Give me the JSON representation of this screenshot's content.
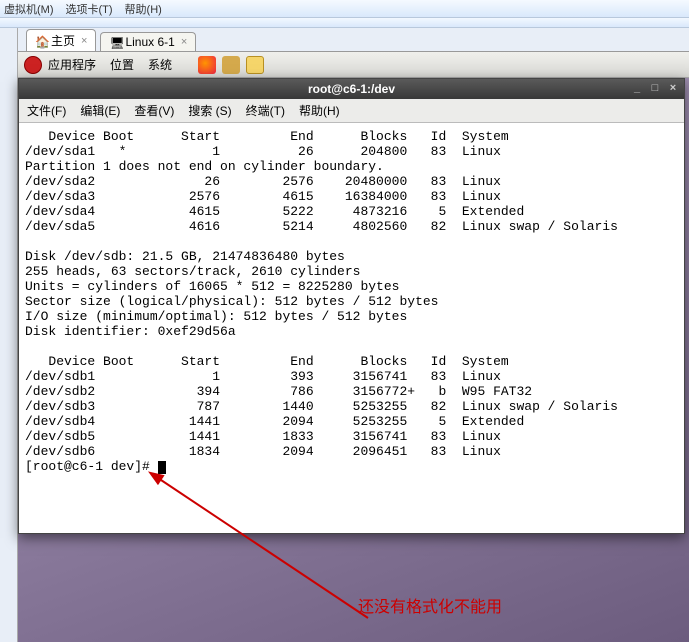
{
  "app_menu": {
    "vm": "虚拟机(M)",
    "tabs": "选项卡(T)",
    "help": "帮助(H)"
  },
  "host_tabs": {
    "home": "主页",
    "vm": "Linux 6-1"
  },
  "gnome": {
    "apps": "应用程序",
    "places": "位置",
    "system": "系统"
  },
  "terminal": {
    "title": "root@c6-1:/dev",
    "menu": {
      "file": "文件(F)",
      "edit": "编辑(E)",
      "view": "查看(V)",
      "search": "搜索 (S)",
      "terminal": "终端(T)",
      "help": "帮助(H)"
    },
    "output": {
      "hdr1": "   Device Boot      Start         End      Blocks   Id  System",
      "sda1": "/dev/sda1   *           1          26      204800   83  Linux",
      "pwarn": "Partition 1 does not end on cylinder boundary.",
      "sda2": "/dev/sda2              26        2576    20480000   83  Linux",
      "sda3": "/dev/sda3            2576        4615    16384000   83  Linux",
      "sda4": "/dev/sda4            4615        5222     4873216    5  Extended",
      "sda5": "/dev/sda5            4616        5214     4802560   82  Linux swap / Solaris",
      "blank1": "",
      "disk": "Disk /dev/sdb: 21.5 GB, 21474836480 bytes",
      "heads": "255 heads, 63 sectors/track, 2610 cylinders",
      "units": "Units = cylinders of 16065 * 512 = 8225280 bytes",
      "sector": "Sector size (logical/physical): 512 bytes / 512 bytes",
      "io": "I/O size (minimum/optimal): 512 bytes / 512 bytes",
      "ident": "Disk identifier: 0xef29d56a",
      "blank2": "",
      "hdr2": "   Device Boot      Start         End      Blocks   Id  System",
      "sdb1": "/dev/sdb1               1         393     3156741   83  Linux",
      "sdb2": "/dev/sdb2             394         786     3156772+   b  W95 FAT32",
      "sdb3": "/dev/sdb3             787        1440     5253255   82  Linux swap / Solaris",
      "sdb4": "/dev/sdb4            1441        2094     5253255    5  Extended",
      "sdb5": "/dev/sdb5            1441        1833     3156741   83  Linux",
      "sdb6": "/dev/sdb6            1834        2094     2096451   83  Linux",
      "prompt": "[root@c6-1 dev]# "
    }
  },
  "annotation": "还没有格式化不能用",
  "chart_data": {
    "type": "table",
    "title": "fdisk -l partition listing",
    "tables": [
      {
        "columns": [
          "Device",
          "Boot",
          "Start",
          "End",
          "Blocks",
          "Id",
          "System"
        ],
        "rows": [
          [
            "/dev/sda1",
            "*",
            1,
            26,
            204800,
            "83",
            "Linux"
          ],
          [
            "/dev/sda2",
            "",
            26,
            2576,
            20480000,
            "83",
            "Linux"
          ],
          [
            "/dev/sda3",
            "",
            2576,
            4615,
            16384000,
            "83",
            "Linux"
          ],
          [
            "/dev/sda4",
            "",
            4615,
            5222,
            4873216,
            "5",
            "Extended"
          ],
          [
            "/dev/sda5",
            "",
            4616,
            5214,
            4802560,
            "82",
            "Linux swap / Solaris"
          ]
        ]
      },
      {
        "disk_line": "Disk /dev/sdb: 21.5 GB, 21474836480 bytes",
        "columns": [
          "Device",
          "Boot",
          "Start",
          "End",
          "Blocks",
          "Id",
          "System"
        ],
        "rows": [
          [
            "/dev/sdb1",
            "",
            1,
            393,
            3156741,
            "83",
            "Linux"
          ],
          [
            "/dev/sdb2",
            "",
            394,
            786,
            "3156772+",
            "b",
            "W95 FAT32"
          ],
          [
            "/dev/sdb3",
            "",
            787,
            1440,
            5253255,
            "82",
            "Linux swap / Solaris"
          ],
          [
            "/dev/sdb4",
            "",
            1441,
            2094,
            5253255,
            "5",
            "Extended"
          ],
          [
            "/dev/sdb5",
            "",
            1441,
            1833,
            3156741,
            "83",
            "Linux"
          ],
          [
            "/dev/sdb6",
            "",
            1834,
            2094,
            2096451,
            "83",
            "Linux"
          ]
        ]
      }
    ]
  }
}
